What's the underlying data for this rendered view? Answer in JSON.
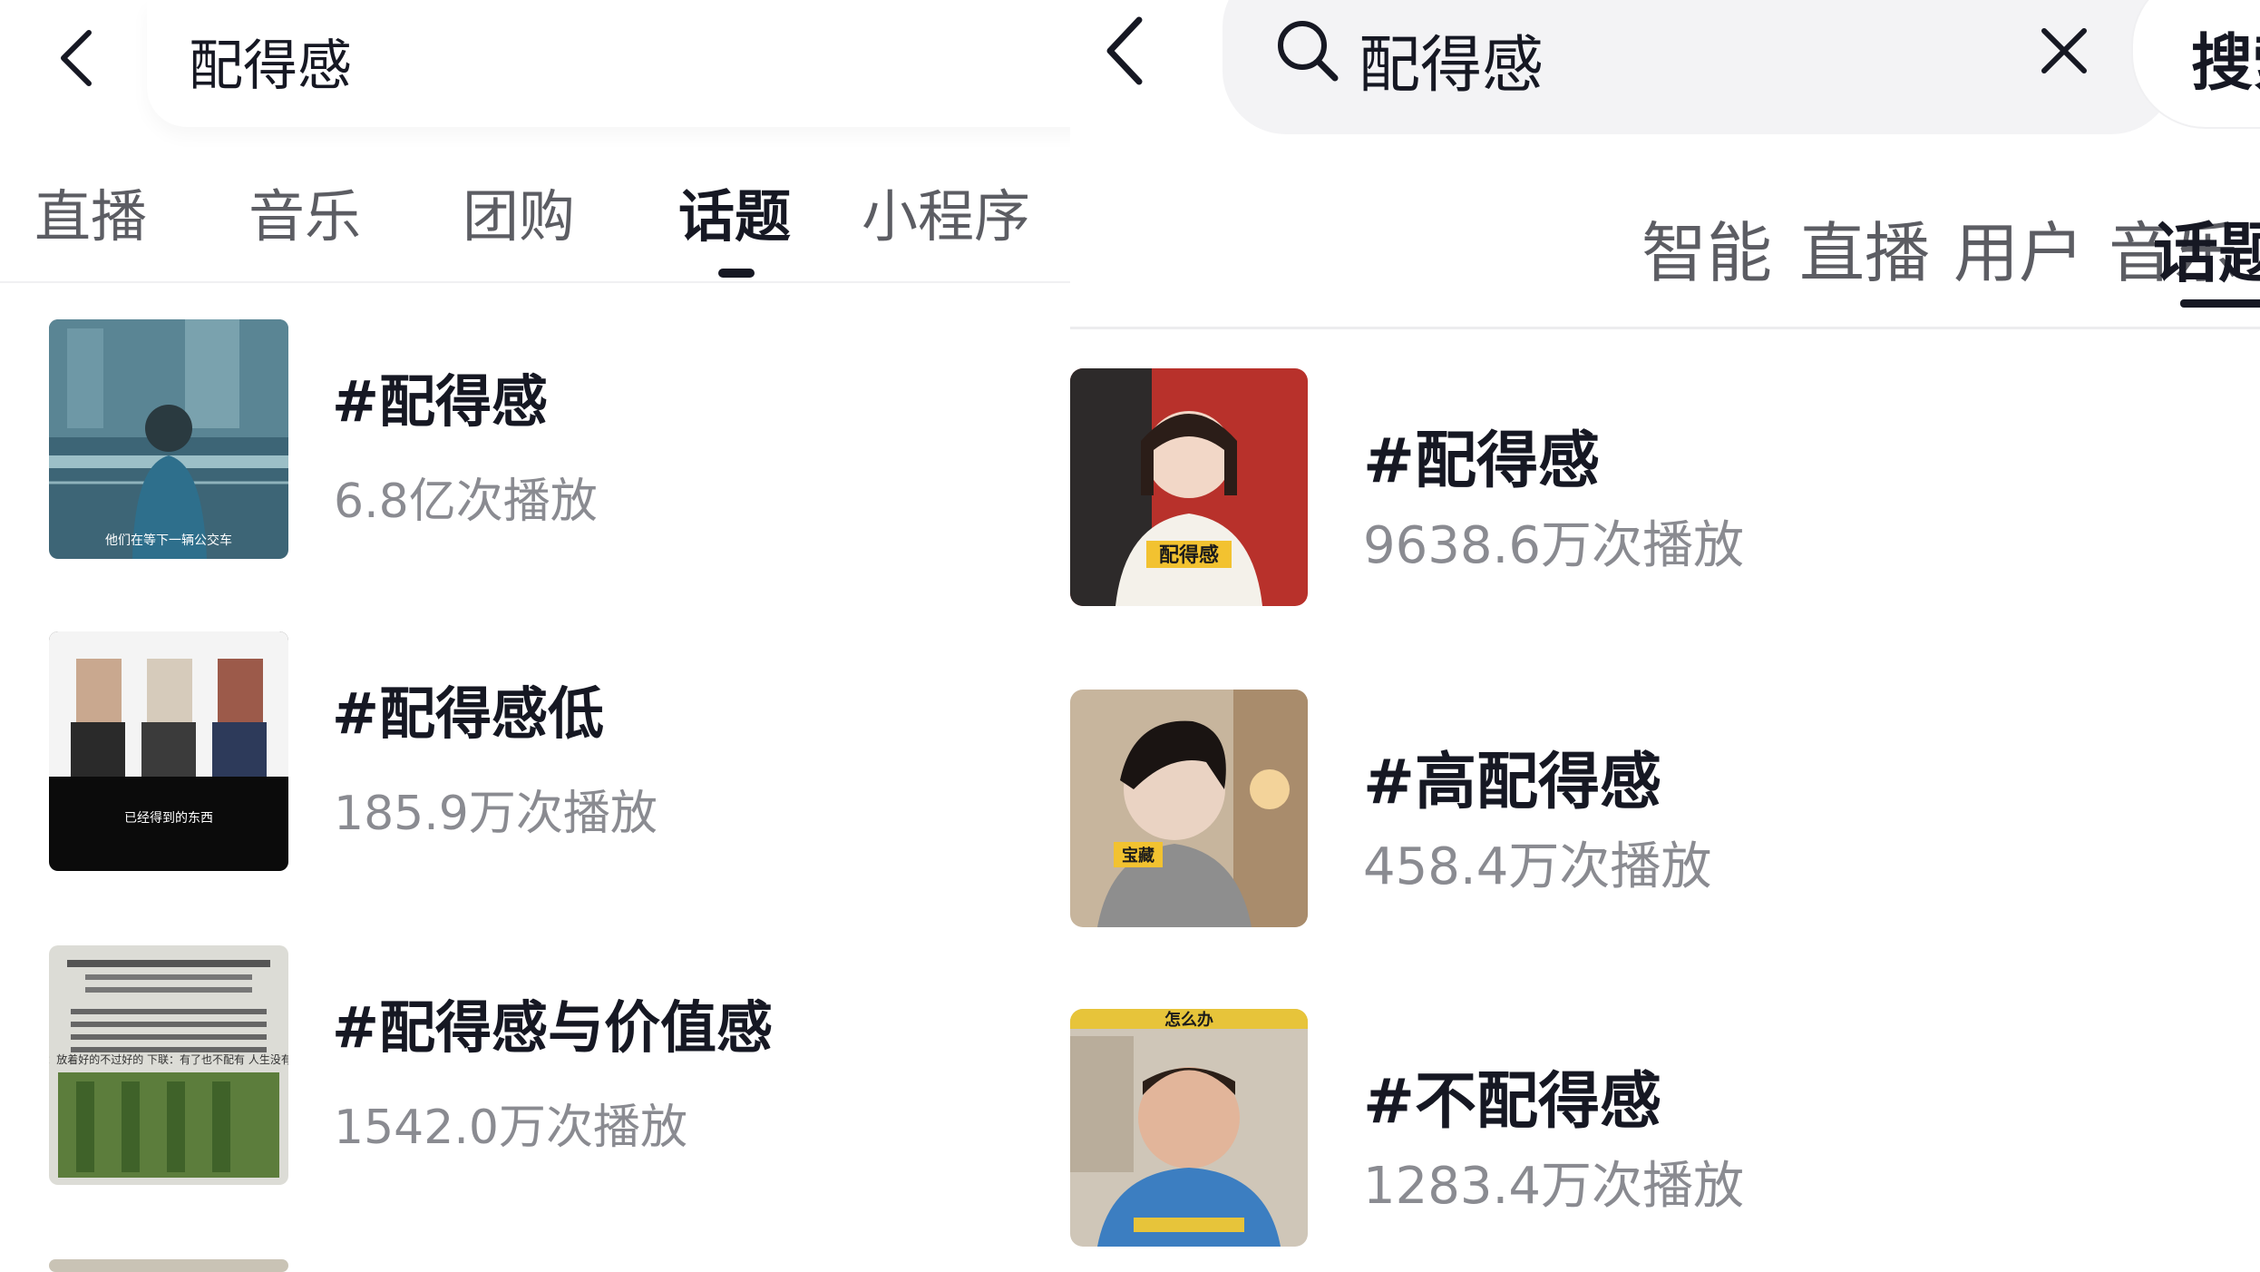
{
  "left_panel": {
    "search_query": "配得感",
    "tabs": [
      {
        "label": "直播",
        "active": false
      },
      {
        "label": "音乐",
        "active": false
      },
      {
        "label": "团购",
        "active": false
      },
      {
        "label": "话题",
        "active": true
      },
      {
        "label": "小程序",
        "active": false
      }
    ],
    "results": [
      {
        "title": "#配得感",
        "plays": "6.8亿次播放",
        "thumb_caption": "他们在等下一辆公交车"
      },
      {
        "title": "#配得感低",
        "plays": "185.9万次播放",
        "thumb_caption": "已经得到的东西"
      },
      {
        "title": "#配得感与价值感",
        "plays": "1542.0万次播放",
        "thumb_caption": "上联：放着好的不过好的 下联：有了也不配有 人生没有如果"
      }
    ]
  },
  "right_panel": {
    "search_query": "配得感",
    "search_button": "搜索",
    "tabs": [
      {
        "label": "智能",
        "active": false
      },
      {
        "label": "直播",
        "active": false
      },
      {
        "label": "用户",
        "active": false
      },
      {
        "label": "音乐",
        "active": false
      },
      {
        "label": "话题",
        "active": true
      }
    ],
    "results": [
      {
        "title": "#配得感",
        "plays": "9638.6万次播放",
        "thumb_caption": "配得感"
      },
      {
        "title": "#高配得感",
        "plays": "458.4万次播放",
        "thumb_caption": "宝藏"
      },
      {
        "title": "#不配得感",
        "plays": "1283.4万次播放",
        "thumb_caption": "怎么办"
      }
    ]
  },
  "colors": {
    "text_primary": "#161823",
    "text_secondary": "#8a8b91",
    "tab_inactive": "#5c5d63",
    "search_bg": "#f3f3f5"
  },
  "icons": [
    "back-arrow-icon",
    "search-icon",
    "clear-icon"
  ]
}
